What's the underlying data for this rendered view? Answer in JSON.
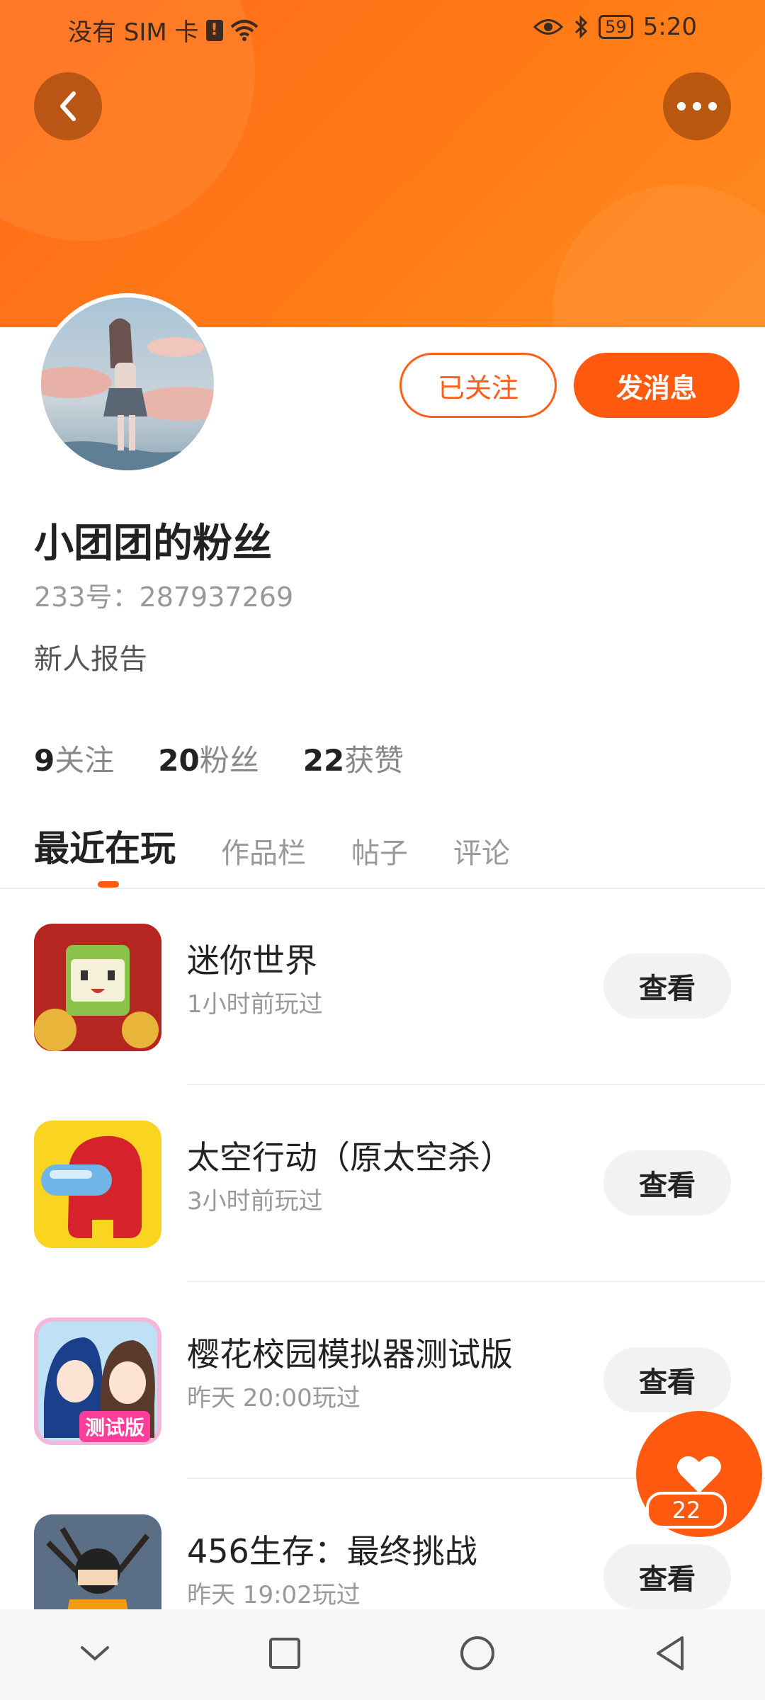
{
  "status_bar": {
    "carrier": "没有 SIM 卡",
    "sim_alert": "!",
    "battery": "59",
    "time": "5:20"
  },
  "header": {
    "back_icon": "back-arrow-icon",
    "more_icon": "more-dots-icon"
  },
  "profile": {
    "followed_label": "已关注",
    "message_label": "发消息",
    "username": "小团团的粉丝",
    "id_text": "233号：287937269",
    "bio": "新人报告",
    "stats": [
      {
        "num": "9",
        "label": "关注"
      },
      {
        "num": "20",
        "label": "粉丝"
      },
      {
        "num": "22",
        "label": "获赞"
      }
    ]
  },
  "tabs": [
    {
      "label": "最近在玩",
      "active": true
    },
    {
      "label": "作品栏",
      "active": false
    },
    {
      "label": "帖子",
      "active": false
    },
    {
      "label": "评论",
      "active": false
    }
  ],
  "games": [
    {
      "name": "迷你世界",
      "time": "1小时前玩过",
      "button": "查看"
    },
    {
      "name": "太空行动（原太空杀）",
      "time": "3小时前玩过",
      "button": "查看"
    },
    {
      "name": "樱花校园模拟器测试版",
      "time": "昨天 20:00玩过",
      "button": "查看",
      "icon_badge": "测试版"
    },
    {
      "name": "456生存：最终挑战",
      "time": "昨天 19:02玩过",
      "button": "查看"
    }
  ],
  "like": {
    "icon": "heart-icon",
    "count": "22"
  },
  "nav": {
    "icons": [
      "chevron-down-icon",
      "square-icon",
      "circle-icon",
      "triangle-back-icon"
    ]
  },
  "colors": {
    "accent": "#ff5a0f",
    "banner": "#ff7b16"
  }
}
